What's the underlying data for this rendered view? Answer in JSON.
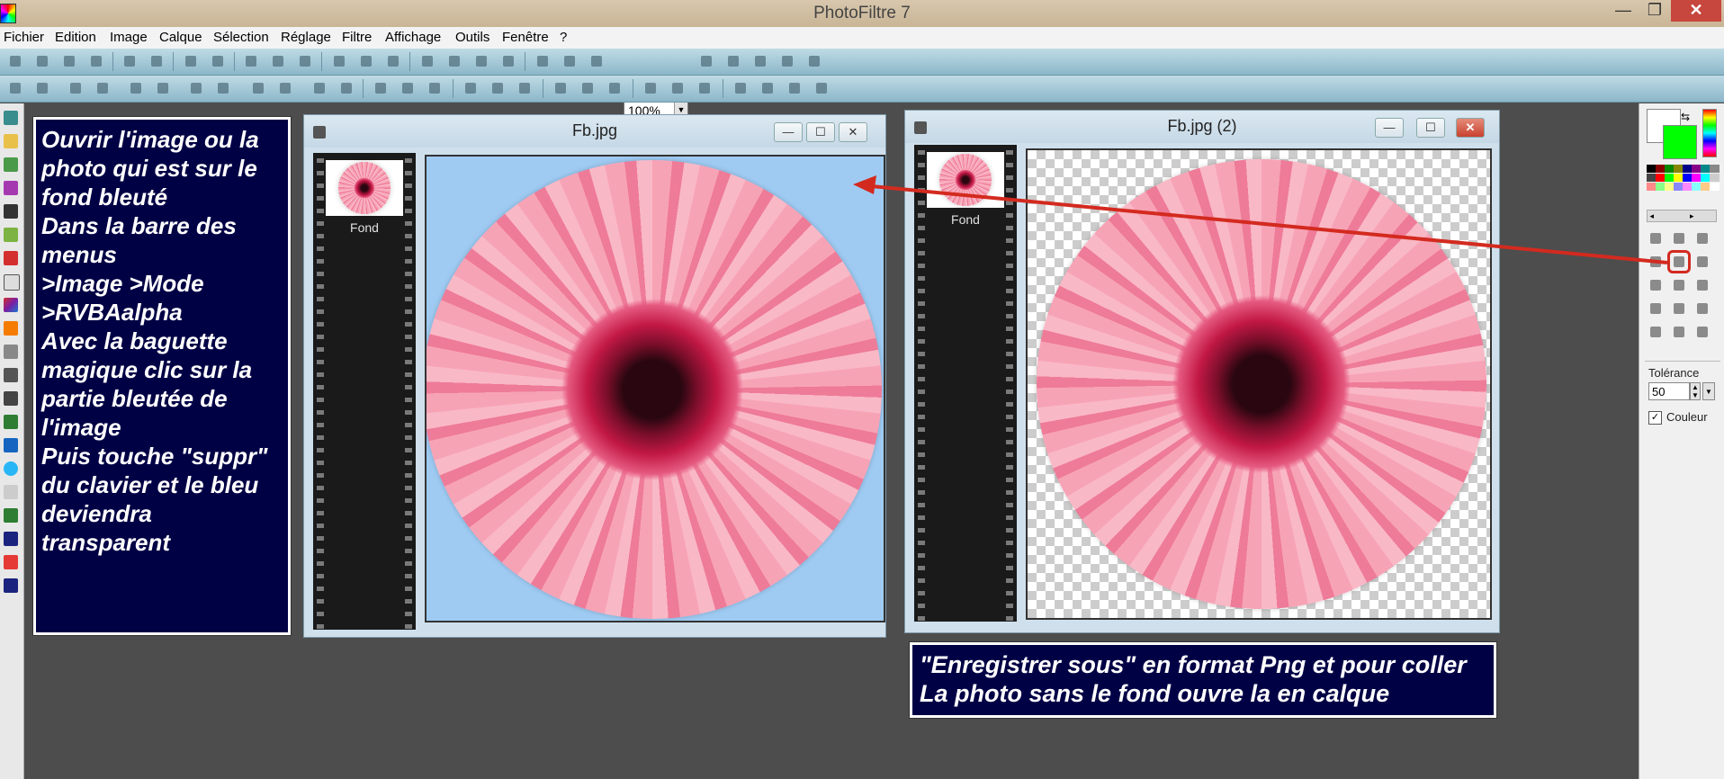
{
  "app": {
    "title": "PhotoFiltre 7",
    "window_buttons": [
      "—",
      "❐",
      "✕"
    ]
  },
  "menu": [
    "Fichier",
    "Edition",
    "Image",
    "Calque",
    "Sélection",
    "Réglage",
    "Filtre",
    "Affichage",
    "Outils",
    "Fenêtre",
    "?"
  ],
  "toolbar": {
    "zoom_value": "100%"
  },
  "left_annotation": {
    "lines": [
      "Ouvrir l'image ou la",
      "photo qui est sur le",
      "fond bleuté",
      "Dans la barre des",
      "menus",
      ">Image >Mode",
      ">RVBAalpha",
      "Avec la baguette",
      "magique clic sur la",
      "partie bleutée de",
      "l'image",
      "Puis touche \"suppr\"",
      "du clavier et le bleu",
      "deviendra",
      "transparent"
    ]
  },
  "doc1": {
    "title": "Fb.jpg",
    "layer_label": "Fond"
  },
  "doc2": {
    "title": "Fb.jpg (2)",
    "layer_label": "Fond"
  },
  "bottom_annotation": {
    "line1": "\"Enregistrer sous\" en format Png et pour coller",
    "line2": "La photo sans le fond ouvre la  en calque"
  },
  "tool_options": {
    "tolerance_label": "Tolérance",
    "tolerance_value": "50",
    "color_label": "Couleur",
    "color_checked": true
  },
  "colors": {
    "annotation_bg": "#000045",
    "arrow": "#d32a1f",
    "canvas_blue": "#9fcbf3"
  }
}
